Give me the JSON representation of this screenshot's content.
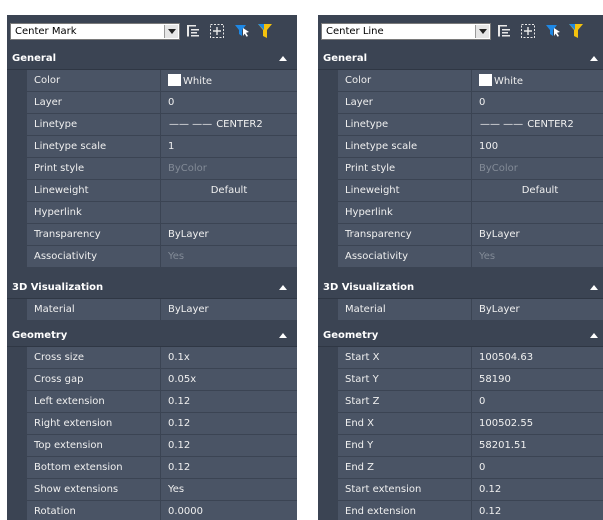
{
  "panels": [
    {
      "selector_value": "Center Mark",
      "sections": [
        {
          "title": "General",
          "rows": [
            {
              "name": "Color",
              "value": "White",
              "swatch": "#ffffff"
            },
            {
              "name": "Layer",
              "value": "0"
            },
            {
              "name": "Linetype",
              "value": "CENTER2",
              "linetype_glyph": "——  ——"
            },
            {
              "name": "Linetype scale",
              "value": "1"
            },
            {
              "name": "Print style",
              "value": "ByColor",
              "dim": true
            },
            {
              "name": "Lineweight",
              "value": "Default",
              "centered": true
            },
            {
              "name": "Hyperlink",
              "value": ""
            },
            {
              "name": "Transparency",
              "value": "ByLayer"
            },
            {
              "name": "Associativity",
              "value": "Yes",
              "dim": true
            }
          ]
        },
        {
          "title": "3D Visualization",
          "rows": [
            {
              "name": "Material",
              "value": "ByLayer"
            }
          ]
        },
        {
          "title": "Geometry",
          "rows": [
            {
              "name": "Cross size",
              "value": "0.1x"
            },
            {
              "name": "Cross gap",
              "value": "0.05x"
            },
            {
              "name": "Left extension",
              "value": "0.12"
            },
            {
              "name": "Right extension",
              "value": "0.12"
            },
            {
              "name": "Top extension",
              "value": "0.12"
            },
            {
              "name": "Bottom extension",
              "value": "0.12"
            },
            {
              "name": "Show extensions",
              "value": "Yes"
            },
            {
              "name": "Rotation",
              "value": "0.0000"
            }
          ]
        }
      ]
    },
    {
      "selector_value": "Center Line",
      "sections": [
        {
          "title": "General",
          "rows": [
            {
              "name": "Color",
              "value": "White",
              "swatch": "#ffffff"
            },
            {
              "name": "Layer",
              "value": "0"
            },
            {
              "name": "Linetype",
              "value": "CENTER2",
              "linetype_glyph": "——  ——"
            },
            {
              "name": "Linetype scale",
              "value": "100"
            },
            {
              "name": "Print style",
              "value": "ByColor",
              "dim": true
            },
            {
              "name": "Lineweight",
              "value": "Default",
              "centered": true
            },
            {
              "name": "Hyperlink",
              "value": ""
            },
            {
              "name": "Transparency",
              "value": "ByLayer"
            },
            {
              "name": "Associativity",
              "value": "Yes",
              "dim": true
            }
          ]
        },
        {
          "title": "3D Visualization",
          "rows": [
            {
              "name": "Material",
              "value": "ByLayer"
            }
          ]
        },
        {
          "title": "Geometry",
          "rows": [
            {
              "name": "Start X",
              "value": "100504.63"
            },
            {
              "name": "Start Y",
              "value": "58190"
            },
            {
              "name": "Start Z",
              "value": "0"
            },
            {
              "name": "End X",
              "value": "100502.55"
            },
            {
              "name": "End Y",
              "value": "58201.51"
            },
            {
              "name": "End Z",
              "value": "0"
            },
            {
              "name": "Start extension",
              "value": "0.12"
            },
            {
              "name": "End extension",
              "value": "0.12"
            }
          ]
        }
      ]
    }
  ],
  "toolbar_icons": [
    "toggle-pickadd-icon",
    "select-objects-icon",
    "quick-select-icon",
    "filter-icon"
  ],
  "colors": {
    "panel_bg": "#3b4453",
    "row_bg": "#4a5465",
    "dim_text": "#838b97",
    "text": "#f0f0f0",
    "quick_select_blue": "#1e88e5",
    "filter_yellow": "#f4c20d"
  }
}
